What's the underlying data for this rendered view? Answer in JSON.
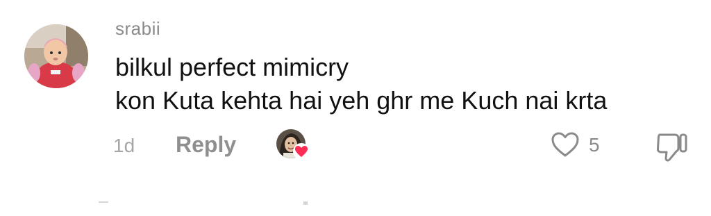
{
  "comment": {
    "username": "srabii",
    "text_lines": [
      "bilkul perfect mimicry",
      "kon Kuta kehta hai yeh ghr me Kuch nai krta"
    ],
    "time": "1d",
    "reply_label": "Reply",
    "likes": "5"
  },
  "icons": {
    "avatar": "user-avatar-photo",
    "creator_liked": "creator-liked-heart-icon",
    "like": "heart-outline-icon",
    "dislike": "thumbs-down-outline-icon"
  },
  "colors": {
    "username": "#8a8a8a",
    "text": "#111111",
    "meta": "#a6a6a6",
    "heart_badge": "#ff2d55"
  }
}
